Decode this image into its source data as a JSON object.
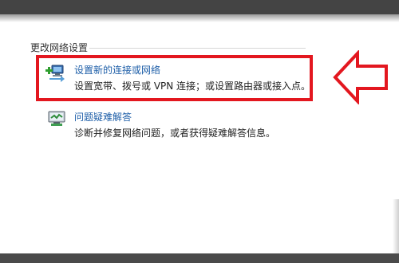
{
  "network_center": {
    "section_title": "更改网络设置",
    "tasks": [
      {
        "label": "设置新的连接或网络",
        "description": "设置宽带、拨号或 VPN 连接；或设置路由器或接入点。",
        "icon": "new-connection-icon"
      },
      {
        "label": "问题疑难解答",
        "description": "诊断并修复网络问题，或者获得疑难解答信息。",
        "icon": "troubleshoot-icon"
      }
    ]
  },
  "annotation": {
    "highlight_color": "#e3171f",
    "arrow_direction": "left"
  },
  "colors": {
    "link": "#1d5ea8",
    "text": "#222222"
  }
}
